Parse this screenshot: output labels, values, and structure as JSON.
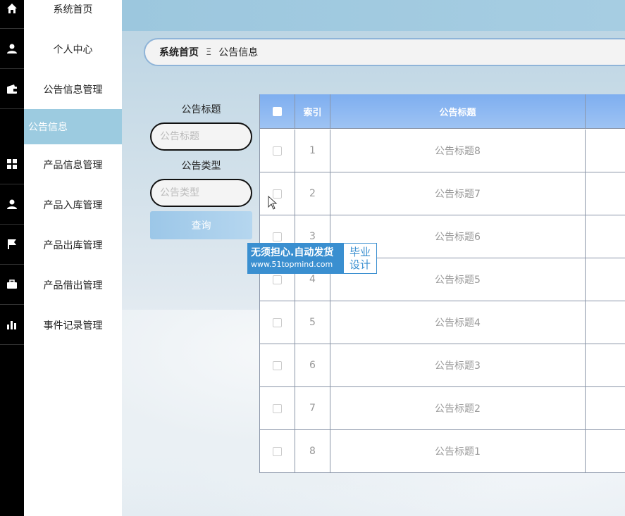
{
  "sidebar": {
    "items": [
      {
        "label": "系统首页",
        "icon": "home-icon"
      },
      {
        "label": "个人中心",
        "icon": "user-icon"
      },
      {
        "label": "公告信息管理",
        "icon": "wallet-icon"
      },
      {
        "label": "公告信息",
        "icon": "",
        "active": true
      },
      {
        "label": "产品信息管理",
        "icon": "grid-icon"
      },
      {
        "label": "产品入库管理",
        "icon": "user-icon"
      },
      {
        "label": "产品出库管理",
        "icon": "flag-icon"
      },
      {
        "label": "产品借出管理",
        "icon": "briefcase-icon"
      },
      {
        "label": "事件记录管理",
        "icon": "bar-chart-icon"
      }
    ]
  },
  "breadcrumb": {
    "home": "系统首页",
    "separator": "Ξ",
    "current": "公告信息"
  },
  "search": {
    "title_label": "公告标题",
    "title_placeholder": "公告标题",
    "type_label": "公告类型",
    "type_placeholder": "公告类型",
    "query_button": "查询"
  },
  "table": {
    "headers": {
      "index": "索引",
      "title": "公告标题"
    },
    "rows": [
      {
        "index": "1",
        "title": "公告标题8"
      },
      {
        "index": "2",
        "title": "公告标题7"
      },
      {
        "index": "3",
        "title": "公告标题6"
      },
      {
        "index": "4",
        "title": "公告标题5"
      },
      {
        "index": "5",
        "title": "公告标题4"
      },
      {
        "index": "6",
        "title": "公告标题3"
      },
      {
        "index": "7",
        "title": "公告标题2"
      },
      {
        "index": "8",
        "title": "公告标题1"
      }
    ]
  },
  "watermark": {
    "line1": "无须担心.自动发货",
    "line2": "www.51topmind.com",
    "badge1": "毕业",
    "badge2": "设计"
  },
  "colors": {
    "active_menu": "#9ccbe0",
    "table_header": "#7eaef0",
    "watermark": "#3a8fd0"
  }
}
